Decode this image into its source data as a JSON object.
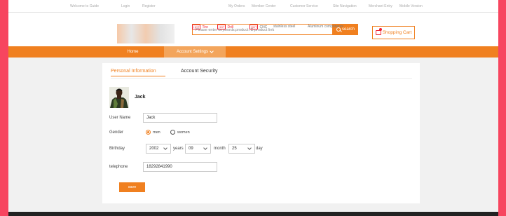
{
  "topbar": {
    "links": [
      "Welcome to Guide",
      "Login",
      "Register",
      "My Orders",
      "Member Center",
      "Customer Service",
      "Site Navigation",
      "Merchant Entry",
      "Mobile Version"
    ]
  },
  "search": {
    "placeholder": "Please enter keywords,product ID,product link",
    "button_label": "search"
  },
  "hot_tags": [
    {
      "badge": "HOT",
      "label": "Tire",
      "highlight": true
    },
    {
      "badge": "HOT",
      "label": "Drill",
      "highlight": true
    },
    {
      "badge": "HOT",
      "label": "CNC",
      "highlight": false
    },
    {
      "badge": "",
      "label": "stainless steel",
      "highlight": false
    },
    {
      "badge": "",
      "label": "Aluminum components",
      "highlight": false
    }
  ],
  "cart": {
    "label": "Shopping Cart"
  },
  "nav": {
    "home": "Home",
    "account": "Account Settings"
  },
  "tabs": {
    "personal": "Personal Information",
    "security": "Account Security"
  },
  "profile": {
    "display_name": "Jack"
  },
  "form": {
    "username_label": "User Name",
    "username_value": "Jack",
    "gender_label": "Gender",
    "gender_options": [
      "men",
      "women"
    ],
    "gender_selected": "men",
    "birthday_label": "Birthday",
    "year_value": "2002",
    "year_unit": "years",
    "month_value": "09",
    "month_unit": "month",
    "day_value": "25",
    "day_unit": "day",
    "telephone_label": "telephone",
    "telephone_value": "18292841990",
    "save_label": "save"
  },
  "colors": {
    "accent": "#f08020",
    "frame": "#f7455f",
    "hot": "#ee2233"
  }
}
